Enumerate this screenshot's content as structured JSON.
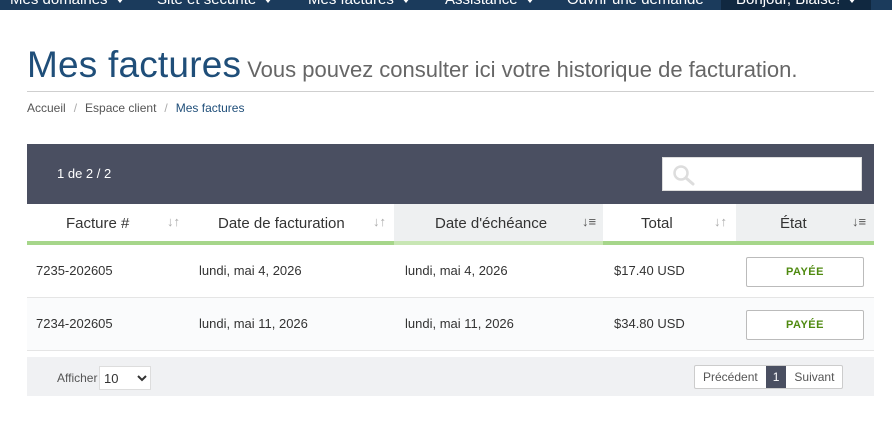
{
  "nav": {
    "items": [
      "Mes domaines",
      "Site et sécurité",
      "Mes factures",
      "Assistance"
    ],
    "open_ticket": "Ouvrir une demande",
    "greeting": "Bonjour, Blaise!"
  },
  "page": {
    "title": "Mes factures",
    "subtitle": "Vous pouvez consulter ici votre historique de facturation."
  },
  "breadcrumb": [
    "Accueil",
    "Espace client",
    "Mes factures"
  ],
  "table": {
    "info": "1 de 2 / 2",
    "search_placeholder": "",
    "columns": [
      "Facture #",
      "Date de facturation",
      "Date d'échéance",
      "Total",
      "État"
    ],
    "rows": [
      {
        "invoice": "7235-202605",
        "date": "lundi, mai 4, 2026",
        "due": "lundi, mai 4, 2026",
        "total": "$17.40 USD",
        "status": "PAYÉE"
      },
      {
        "invoice": "7234-202605",
        "date": "lundi, mai 11, 2026",
        "due": "lundi, mai 11, 2026",
        "total": "$34.80 USD",
        "status": "PAYÉE"
      }
    ]
  },
  "footer": {
    "show_label": "Afficher",
    "page_size": "10",
    "page_size_options": [
      "10"
    ],
    "prev": "Précédent",
    "current_page": "1",
    "next": "Suivant"
  },
  "colors": {
    "nav_bg": "#1b3b5c",
    "title": "#1f4e79",
    "table_bar": "#4a4f61",
    "accent_green": "#a6d68a",
    "status_text": "#4f8a10"
  }
}
